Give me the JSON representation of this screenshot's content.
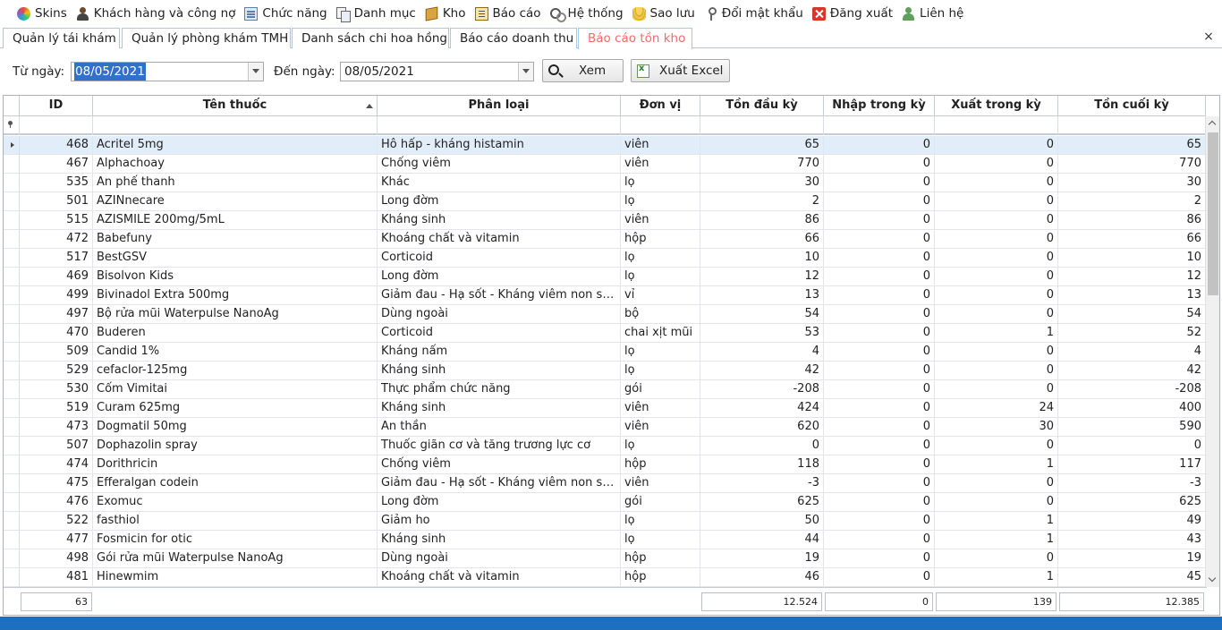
{
  "menu": [
    {
      "label": "Skins",
      "icon": "skins-icon"
    },
    {
      "label": "Khách hàng và công nợ",
      "icon": "customer-icon"
    },
    {
      "label": "Chức năng",
      "icon": "function-icon"
    },
    {
      "label": "Danh mục",
      "icon": "catalog-icon"
    },
    {
      "label": "Kho",
      "icon": "warehouse-icon"
    },
    {
      "label": "Báo cáo",
      "icon": "report-icon"
    },
    {
      "label": "Hệ thống",
      "icon": "system-icon"
    },
    {
      "label": "Sao lưu",
      "icon": "backup-icon"
    },
    {
      "label": "Đổi mật khẩu",
      "icon": "key-icon"
    },
    {
      "label": "Đăng xuất",
      "icon": "logout-icon"
    },
    {
      "label": "Liên hệ",
      "icon": "contact-icon"
    }
  ],
  "tabs": [
    {
      "label": "Quản lý tái khám"
    },
    {
      "label": "Quản lý phòng khám TMH"
    },
    {
      "label": "Danh sách chi hoa hồng"
    },
    {
      "label": "Báo cáo doanh thu"
    },
    {
      "label": "Báo cáo tồn kho"
    }
  ],
  "tab_close": "×",
  "filter": {
    "from_label": "Từ ngày:",
    "from_value": "08/05/2021",
    "to_label": "Đến ngày:",
    "to_value": "08/05/2021",
    "view_label": "Xem",
    "export_label": "Xuất Excel"
  },
  "columns": [
    "ID",
    "Tên thuốc",
    "Phân loại",
    "Đơn vị",
    "Tồn đầu kỳ",
    "Nhập trong kỳ",
    "Xuất trong kỳ",
    "Tồn cuối kỳ"
  ],
  "sorted_column": "Tên thuốc",
  "rows": [
    [
      "468",
      "Acritel 5mg",
      "Hô hấp - kháng histamin",
      "viên",
      "65",
      "0",
      "0",
      "65"
    ],
    [
      "467",
      "Alphachoay",
      "Chống viêm",
      "viên",
      "770",
      "0",
      "0",
      "770"
    ],
    [
      "535",
      "An phế thanh",
      "Khác",
      "lọ",
      "30",
      "0",
      "0",
      "30"
    ],
    [
      "501",
      "AZINnecare",
      "Long đờm",
      "lọ",
      "2",
      "0",
      "0",
      "2"
    ],
    [
      "515",
      "AZISMILE 200mg/5mL",
      "Kháng sinh",
      "viên",
      "86",
      "0",
      "0",
      "86"
    ],
    [
      "472",
      "Babefuny",
      "Khoáng chất và vitamin",
      "hộp",
      "66",
      "0",
      "0",
      "66"
    ],
    [
      "517",
      "BestGSV",
      "Corticoid",
      "lọ",
      "10",
      "0",
      "0",
      "10"
    ],
    [
      "469",
      "Bisolvon Kids",
      "Long đờm",
      "lọ",
      "12",
      "0",
      "0",
      "12"
    ],
    [
      "499",
      "Bivinadol Extra 500mg",
      "Giảm đau - Hạ sốt - Kháng viêm non ste...",
      "vỉ",
      "13",
      "0",
      "0",
      "13"
    ],
    [
      "497",
      "Bộ rửa mũi Waterpulse NanoAg",
      "Dùng ngoài",
      "bộ",
      "54",
      "0",
      "0",
      "54"
    ],
    [
      "470",
      "Buderen",
      "Corticoid",
      "chai xịt mũi",
      "53",
      "0",
      "1",
      "52"
    ],
    [
      "509",
      "Candid 1%",
      "Kháng nấm",
      "lọ",
      "4",
      "0",
      "0",
      "4"
    ],
    [
      "529",
      "cefaclor-125mg",
      "Kháng sinh",
      "lọ",
      "42",
      "0",
      "0",
      "42"
    ],
    [
      "530",
      "Cốm Vimitai",
      "Thực phẩm chức năng",
      "gói",
      "-208",
      "0",
      "0",
      "-208"
    ],
    [
      "519",
      "Curam 625mg",
      "Kháng sinh",
      "viên",
      "424",
      "0",
      "24",
      "400"
    ],
    [
      "473",
      "Dogmatil 50mg",
      "An thần",
      "viên",
      "620",
      "0",
      "30",
      "590"
    ],
    [
      "507",
      "Dophazolin spray",
      "Thuốc giãn cơ và tăng trương lực cơ",
      "lọ",
      "0",
      "0",
      "0",
      "0"
    ],
    [
      "474",
      "Dorithricin",
      "Chống viêm",
      "hộp",
      "118",
      "0",
      "1",
      "117"
    ],
    [
      "475",
      "Efferalgan codein",
      "Giảm đau - Hạ sốt - Kháng viêm non ste...",
      "viên",
      "-3",
      "0",
      "0",
      "-3"
    ],
    [
      "476",
      "Exomuc",
      "Long đờm",
      "gói",
      "625",
      "0",
      "0",
      "625"
    ],
    [
      "522",
      "fasthiol",
      "Giảm ho",
      "lọ",
      "50",
      "0",
      "1",
      "49"
    ],
    [
      "477",
      "Fosmicin for otic",
      "Kháng sinh",
      "lọ",
      "44",
      "0",
      "1",
      "43"
    ],
    [
      "498",
      "Gói rửa mũi Waterpulse NanoAg",
      "Dùng ngoài",
      "hộp",
      "19",
      "0",
      "0",
      "19"
    ],
    [
      "481",
      "Hinewmim",
      "Khoáng chất và vitamin",
      "hộp",
      "46",
      "0",
      "1",
      "45"
    ]
  ],
  "totals": {
    "count": "63",
    "opening": "12.524",
    "imported": "0",
    "exported": "139",
    "closing": "12.385"
  },
  "colors": {
    "active_tab_text": "#f06a6a",
    "selection": "#3370cc",
    "selected_row": "#e1edf9",
    "statusbar": "#1d6fc0"
  }
}
